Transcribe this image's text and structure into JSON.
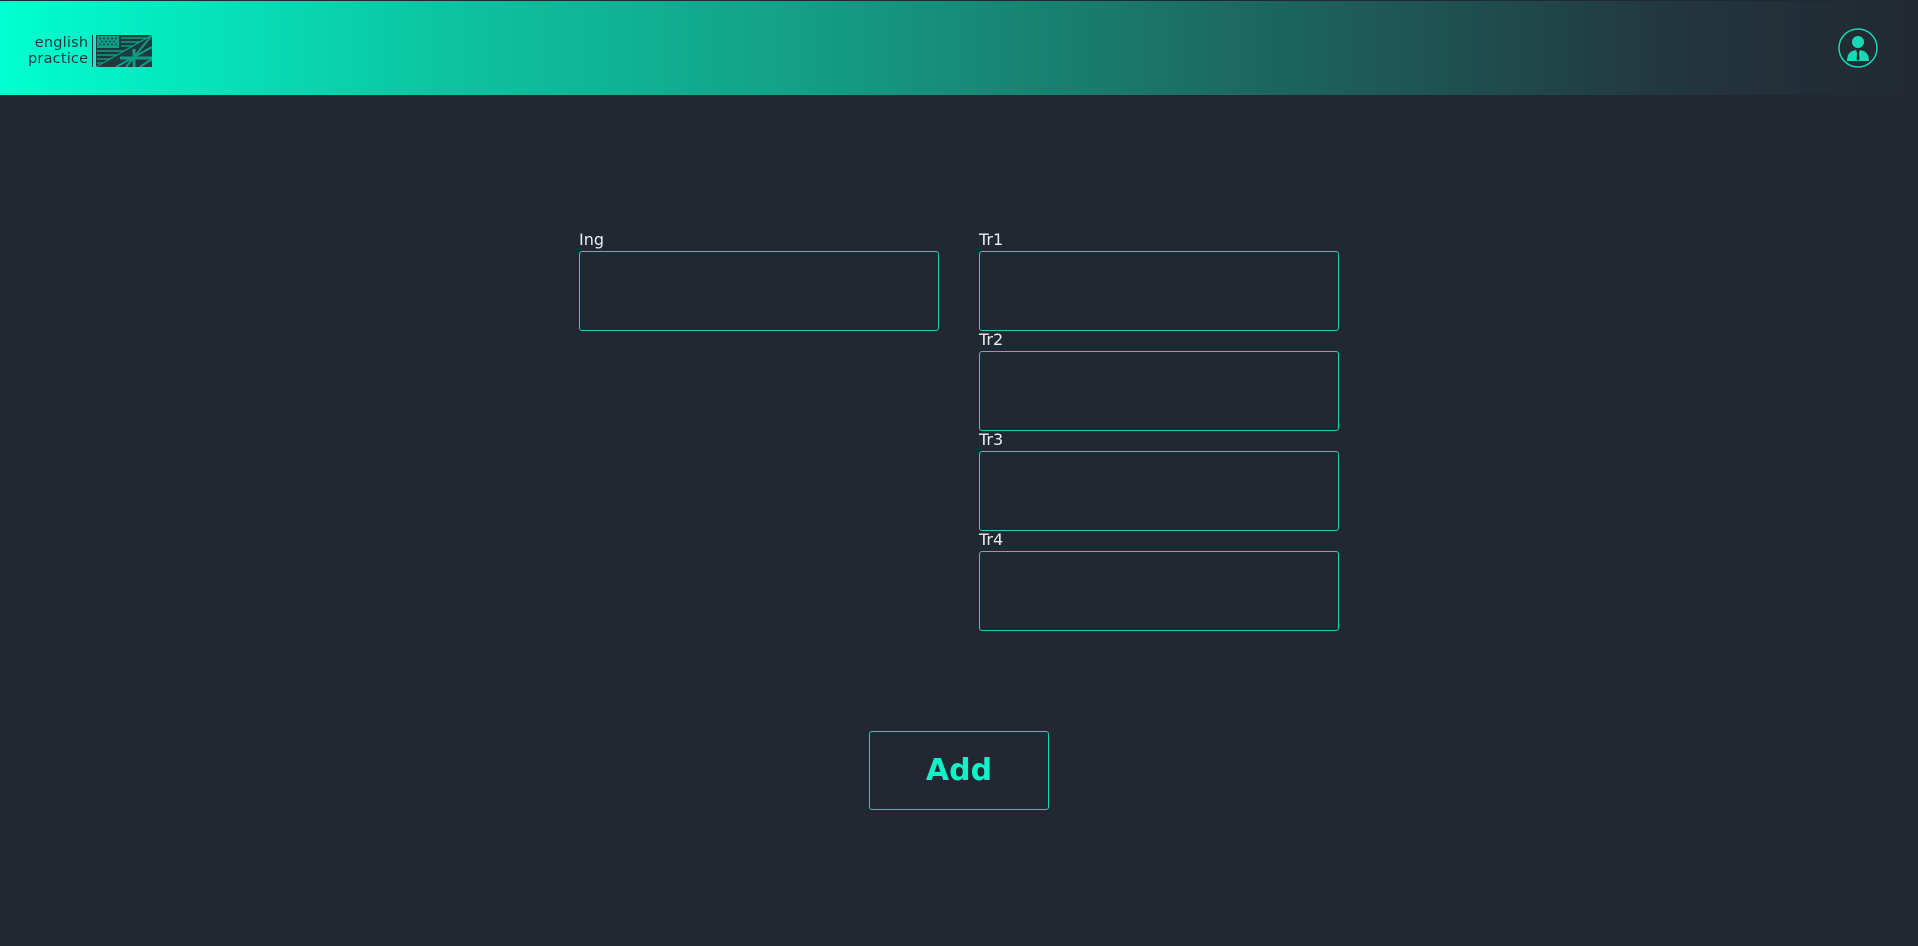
{
  "header": {
    "logo": {
      "line1": "english",
      "line2": "practice",
      "flag_icon": "us-uk-flag-icon"
    },
    "user_icon": "user-avatar-icon"
  },
  "form": {
    "ing": {
      "label": "Ing",
      "value": ""
    },
    "tr1": {
      "label": "Tr1",
      "value": ""
    },
    "tr2": {
      "label": "Tr2",
      "value": ""
    },
    "tr3": {
      "label": "Tr3",
      "value": ""
    },
    "tr4": {
      "label": "Tr4",
      "value": ""
    },
    "add_label": "Add"
  },
  "colors": {
    "background": "#222831",
    "accent": "#18d8b5",
    "header_gradient_start": "#00ffd0",
    "header_gradient_end": "#222831",
    "text": "#e9edf0"
  }
}
